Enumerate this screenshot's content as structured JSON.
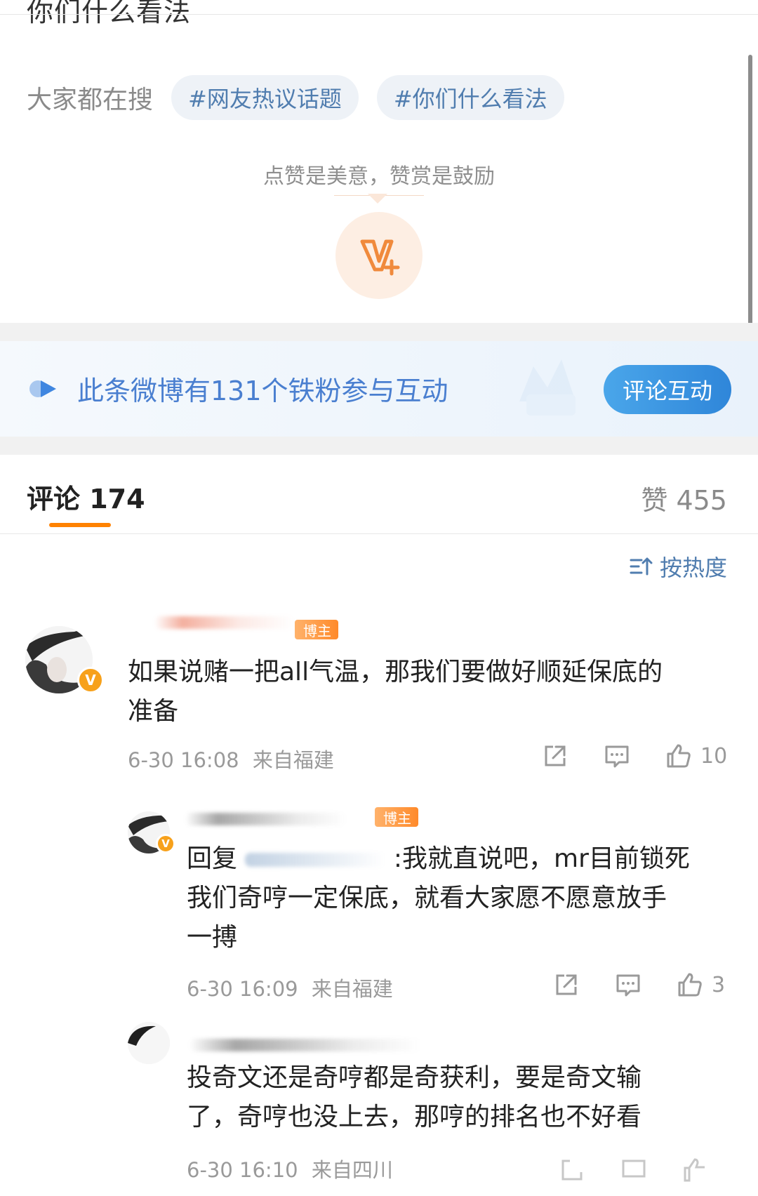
{
  "post": {
    "title_fragment": "你们什么看法",
    "search_label": "大家都在搜",
    "tags": [
      "#网友热议话题",
      "#你们什么看法"
    ],
    "reward_text": "点赞是美意，赞赏是鼓励",
    "reward_icon": "v-plus-icon"
  },
  "fans_bar": {
    "text": "此条微博有131个铁粉参与互动",
    "button": "评论互动"
  },
  "comments_header": {
    "label": "评论 174",
    "likes": "赞 455",
    "sort": "按热度"
  },
  "comments": [
    {
      "badge": "博主",
      "verified": "V",
      "text_line1": "如果说赌一把all气温，那我们要做好顺延保底的",
      "text_line2": "准备",
      "time": "6-30 16:08",
      "location": "来自福建",
      "like_count": "10"
    },
    {
      "badge": "博主",
      "verified": "V",
      "reply_prefix": "回复",
      "text_line1_tail": ":我就直说吧，mr目前锁死",
      "text_line2": "我们奇哼一定保底，就看大家愿不愿意放手",
      "text_line3": "一搏",
      "time": "6-30 16:09",
      "location": "来自福建",
      "like_count": "3"
    },
    {
      "text_line1": "投奇文还是奇哼都是奇获利，要是奇文输",
      "text_line2": "了，奇哼也没上去，那哼的排名也不好看",
      "time": "6-30 16:10",
      "location": "来自四川"
    }
  ],
  "colors": {
    "accent_orange": "#ff8200",
    "link_blue": "#507daf",
    "fans_blue": "#4a7fd0",
    "button_blue": "#2f86d9"
  }
}
